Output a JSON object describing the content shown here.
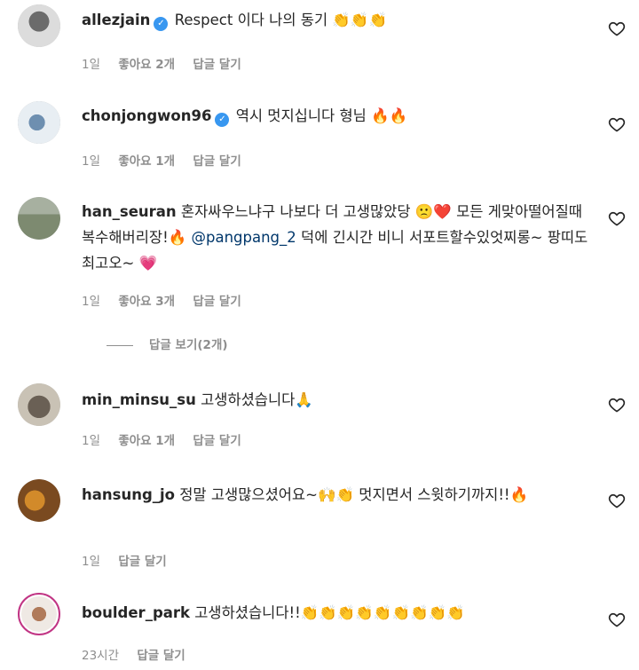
{
  "comments": [
    {
      "username": "allezjain",
      "verified": true,
      "text": "Respect 이다 나의 동기 👏👏👏",
      "time": "1일",
      "likes": "좋아요 2개",
      "reply": "답글 달기"
    },
    {
      "username": "chonjongwon96",
      "verified": true,
      "text": "역시 멋지십니다 형님 🔥🔥",
      "time": "1일",
      "likes": "좋아요 1개",
      "reply": "답글 달기"
    },
    {
      "username": "han_seuran",
      "verified": false,
      "text_before": "혼자싸우느냐구 나보다 더 고생많았당 🙁❤️ 모든 게맞아떨어질때 복수해버리장!🔥 ",
      "mention": "@pangpang_2",
      "text_after": " 덕에 긴시간 비니 서포트할수있엇찌롱~ 팡띠도 최고오~ 💗",
      "time": "1일",
      "likes": "좋아요 3개",
      "reply": "답글 달기"
    },
    {
      "username": "min_minsu_su",
      "verified": false,
      "text": "고생하셨습니다🙏",
      "time": "1일",
      "likes": "좋아요 1개",
      "reply": "답글 달기"
    },
    {
      "username": "hansung_jo",
      "verified": false,
      "text": "정말 고생많으셨어요~🙌👏 멋지면서 스윗하기까지!!🔥",
      "time": "1일",
      "reply": "답글 달기"
    },
    {
      "username": "boulder_park",
      "verified": false,
      "text": "고생하셨습니다!!👏👏👏👏👏👏👏👏👏",
      "time": "23시간",
      "reply": "답글 달기"
    }
  ],
  "view_replies": "답글 보기(2개)",
  "colors": {
    "text": "#262626",
    "secondary": "#8e8e8e",
    "mention": "#00376b",
    "verified": "#3897f0"
  }
}
